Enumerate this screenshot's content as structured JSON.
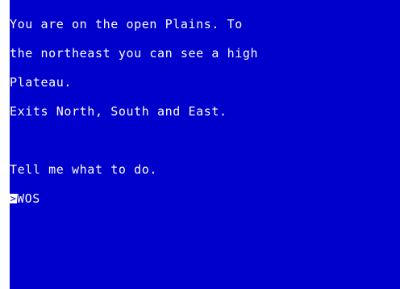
{
  "game": {
    "lines": [
      "You are on the open Plains. To",
      "the northeast you can see a high",
      "Plateau.",
      "Exits North, South and East."
    ],
    "prompt": "Tell me what to do.",
    "cursor_glyph": ">",
    "input_text": "WOS"
  },
  "colors": {
    "background": "#0000cc",
    "text": "#ffffff",
    "border": "#ffffff"
  }
}
